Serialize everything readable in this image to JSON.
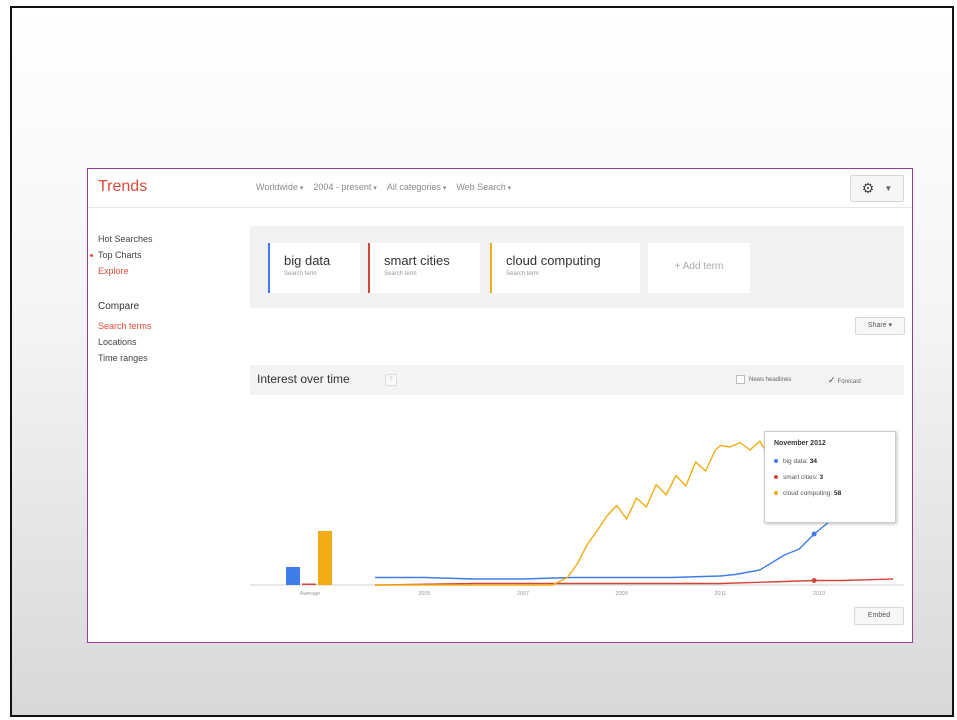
{
  "brand": "Trends",
  "filters": [
    "Worldwide",
    "2004 - present",
    "All categories",
    "Web Search"
  ],
  "settings": {
    "icon": "gear-icon"
  },
  "sidebar": {
    "links": [
      "Hot Searches",
      "Top Charts",
      "Explore"
    ],
    "compare_heading": "Compare",
    "compare_links": [
      "Search terms",
      "Locations",
      "Time ranges"
    ]
  },
  "terms": [
    {
      "name": "big data",
      "sub": "Search term",
      "color": "#3f7ee8"
    },
    {
      "name": "smart cities",
      "sub": "Search term",
      "color": "#d0473a"
    },
    {
      "name": "cloud computing",
      "sub": "Search term",
      "color": "#f0ac14"
    }
  ],
  "add_term": "+ Add term",
  "share_label": "Share",
  "interest": {
    "title": "Interest over time",
    "info": "?",
    "news_label": "News headlines",
    "forecast_label": "Forecast"
  },
  "tooltip": {
    "title": "November 2012",
    "rows": [
      {
        "label": "big data",
        "value": "34",
        "color": "#3f7ee8"
      },
      {
        "label": "smart cities",
        "value": "3",
        "color": "#d0473a"
      },
      {
        "label": "cloud computing",
        "value": "58",
        "color": "#f0ac14"
      }
    ]
  },
  "embed_label": "Embed",
  "chart_data": {
    "type": "line",
    "average_label": "Average",
    "averages": [
      {
        "name": "big data",
        "value": 12,
        "color": "#3f7ee8"
      },
      {
        "name": "smart cities",
        "value": 1,
        "color": "#d0473a"
      },
      {
        "name": "cloud computing",
        "value": 36,
        "color": "#f0ac14"
      }
    ],
    "x_ticks": [
      "2005",
      "2007",
      "2009",
      "2011",
      "2013"
    ],
    "x_range": [
      2004.0,
      2014.6
    ],
    "ylim": [
      0,
      100
    ],
    "series": [
      {
        "name": "big data",
        "color": "#3f7ee8",
        "x": [
          2004.0,
          2005.0,
          2006.0,
          2007.0,
          2008.0,
          2009.0,
          2010.0,
          2011.0,
          2011.3,
          2011.8,
          2012.0,
          2012.3,
          2012.6,
          2012.9,
          2013.2
        ],
        "y": [
          5,
          5,
          4,
          4,
          5,
          5,
          5,
          6,
          7,
          10,
          14,
          20,
          24,
          34,
          42
        ]
      },
      {
        "name": "smart cities",
        "color": "#d0473a",
        "x": [
          2004.0,
          2006.0,
          2008.0,
          2010.0,
          2011.0,
          2012.0,
          2012.9,
          2013.5,
          2014.5
        ],
        "y": [
          0,
          1,
          1,
          1,
          1,
          2,
          3,
          3,
          4
        ]
      },
      {
        "name": "cloud computing",
        "color": "#f0ac14",
        "x": [
          2004.0,
          2007.6,
          2007.9,
          2008.1,
          2008.3,
          2008.5,
          2008.7,
          2008.9,
          2009.1,
          2009.3,
          2009.5,
          2009.7,
          2009.9,
          2010.1,
          2010.3,
          2010.5,
          2010.7,
          2010.9,
          2011.0,
          2011.2,
          2011.4,
          2011.6,
          2011.8,
          2012.0,
          2012.2,
          2012.4,
          2012.6,
          2012.9
        ],
        "y": [
          0,
          0,
          5,
          14,
          27,
          36,
          46,
          53,
          44,
          58,
          52,
          67,
          60,
          73,
          66,
          82,
          76,
          90,
          93,
          92,
          95,
          90,
          96,
          85,
          92,
          88,
          86,
          58
        ]
      }
    ]
  }
}
